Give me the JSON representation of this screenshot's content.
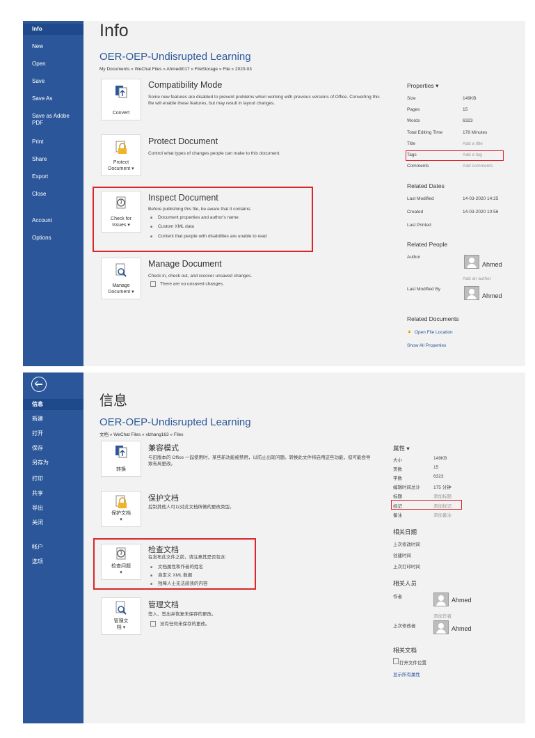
{
  "en": {
    "sidebar": [
      "Info",
      "New",
      "Open",
      "Save",
      "Save As",
      "Save as Adobe\nPDF",
      "Print",
      "Share",
      "Export",
      "Close",
      "Account",
      "Options"
    ],
    "title": "Info",
    "doc_name": "OER-OEP-Undisrupted Learning",
    "doc_path": "My Documents » WeChat Files » Ahmedt017 » FileStorage » File » 2020-03",
    "compat": {
      "tile": "Convert",
      "title": "Compatibility Mode",
      "desc": "Some new features are disabled to prevent problems when working with previous versions of Office. Converting this file will enable these features, but may result in layout changes."
    },
    "protect": {
      "tile": "Protect\nDocument ▾",
      "title": "Protect Document",
      "desc": "Control what types of changes people can make to this document."
    },
    "inspect": {
      "tile": "Check for\nIssues ▾",
      "title": "Inspect Document",
      "desc": "Before publishing this file, be aware that it contains:",
      "items": [
        "Document properties and author's name",
        "Custom XML data",
        "Content that people with disabilities are unable to read"
      ]
    },
    "manage": {
      "tile": "Manage\nDocument ▾",
      "title": "Manage Document",
      "desc": "Check in, check out, and recover unsaved changes.",
      "item": "There are no unsaved changes."
    },
    "props": {
      "head": "Properties ▾",
      "rows": [
        [
          "Size",
          "149KB"
        ],
        [
          "Pages",
          "15"
        ],
        [
          "Words",
          "6323"
        ],
        [
          "Total Editing Time",
          "178 Minutes"
        ],
        [
          "Title",
          "Add a title"
        ],
        [
          "Tags",
          "Add a tag"
        ],
        [
          "Comments",
          "Add comments"
        ]
      ],
      "dates_head": "Related Dates",
      "dates": [
        [
          "Last Modified",
          "14-03-2020 14:25"
        ],
        [
          "Created",
          "14-03-2020 10:56"
        ],
        [
          "Last Printed",
          ""
        ]
      ],
      "people_head": "Related People",
      "author_k": "Author",
      "author": "Ahmed",
      "add_author": "Add an author",
      "lastmod_k": "Last Modified By",
      "lastmod": "Ahmed",
      "docs_head": "Related Documents",
      "open_loc": "Open File Location",
      "show_all": "Show All Properties"
    }
  },
  "zh": {
    "sidebar": [
      "信息",
      "新建",
      "打开",
      "保存",
      "另存为",
      "打印",
      "共享",
      "导出",
      "关闭",
      "帐户",
      "选项"
    ],
    "title": "信息",
    "doc_name": "OER-OEP-Undisrupted Learning",
    "doc_path": "文档 » WeChat Files » xlzhang163 » Files",
    "compat": {
      "tile": "转换",
      "title": "兼容模式",
      "desc": "与旧版本的 Office 一起使用时，某些新功能被禁用，以防止出现问题。转换此文件将启用这些功能，但可能会导致布局更改。"
    },
    "protect": {
      "tile": "保护文档\n▾",
      "title": "保护文档",
      "desc": "控制其他人可以对此文档所做的更改类型。"
    },
    "inspect": {
      "tile": "检查问题\n▾",
      "title": "检查文档",
      "desc": "在发布此文件之前，请注意其是否包含:",
      "items": [
        "文档属性和作者的姓名",
        "自定义 XML 数据",
        "残障人士无法阅读的内容"
      ]
    },
    "manage": {
      "tile": "管理文\n档 ▾",
      "title": "管理文档",
      "desc": "签入、签出并恢复未保存的更改。",
      "item": "没有任何未保存的更改。"
    },
    "props": {
      "head": "属性 ▾",
      "rows": [
        [
          "大小",
          "149KB"
        ],
        [
          "页数",
          "15"
        ],
        [
          "字数",
          "6323"
        ],
        [
          "编辑时间总计",
          "175 分钟"
        ],
        [
          "标题",
          "添加标题"
        ],
        [
          "标记",
          "添加标记"
        ],
        [
          "备注",
          "添加备注"
        ]
      ],
      "dates_head": "相关日期",
      "dates": [
        [
          "上次修改时间",
          ""
        ],
        [
          "创建时间",
          ""
        ],
        [
          "上次打印时间",
          ""
        ]
      ],
      "people_head": "相关人员",
      "author_k": "作者",
      "author": "Ahmed",
      "add_author": "添加作者",
      "lastmod_k": "上次修改者",
      "lastmod": "Ahmed",
      "docs_head": "相关文档",
      "open_loc": "打开文件位置",
      "show_all": "显示所有属性"
    }
  }
}
